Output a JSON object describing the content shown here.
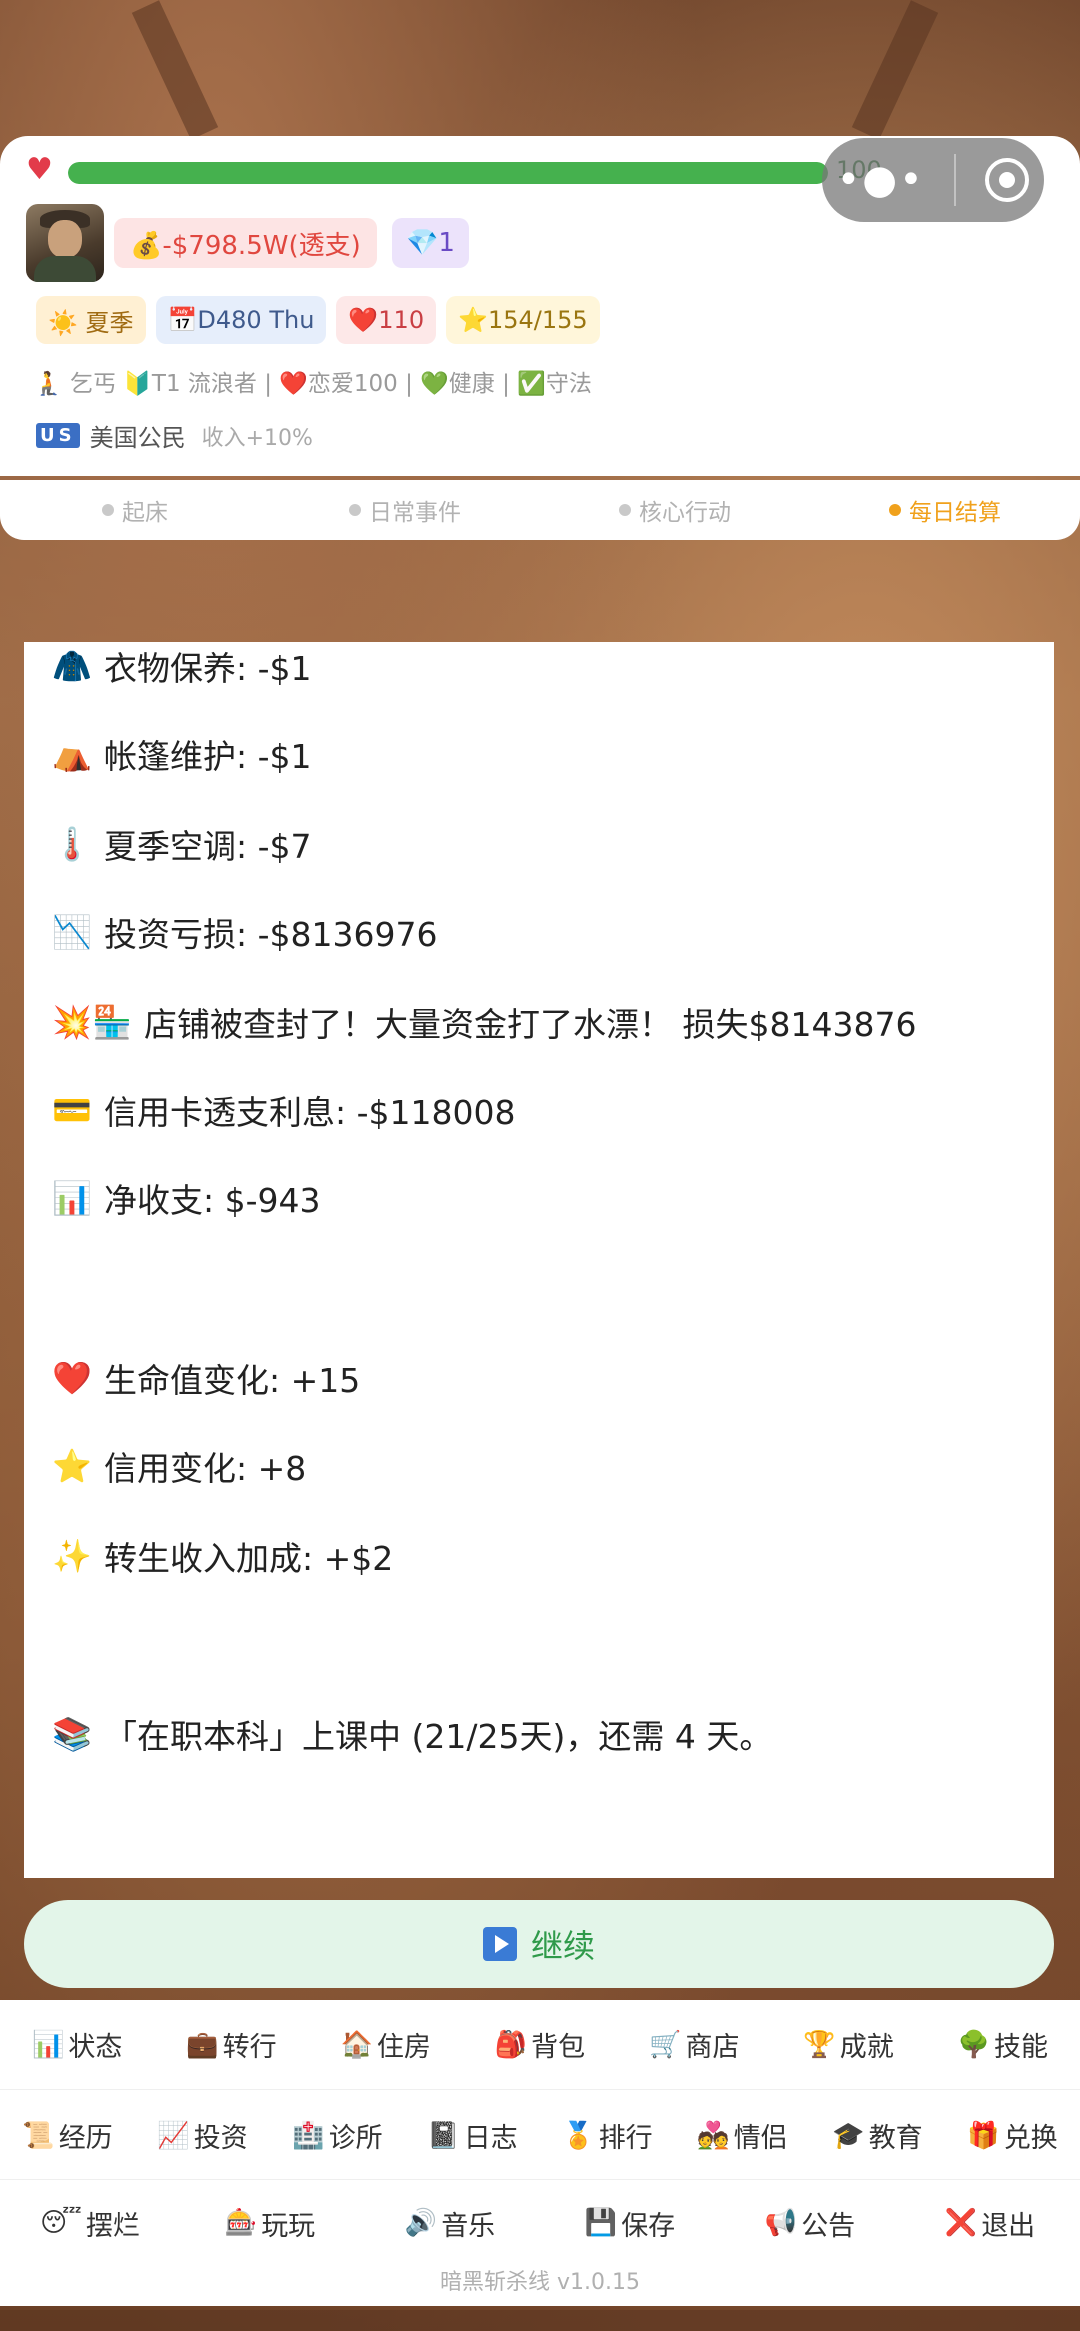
{
  "header": {
    "hp": {
      "value": "100",
      "fraction": 1.0
    },
    "money": "💰-$798.5W(透支)",
    "gems": "💎1",
    "chips": {
      "season": "☀️ 夏季",
      "day": "📅D480 Thu",
      "hp": "❤️110",
      "credit": "⭐154/155"
    },
    "status_line": "🧎 乞丐 🔰T1 流浪者 | ❤️恋爱100 | 💚健康 | ✅守法",
    "citizen": {
      "flag": "US",
      "label": "美国公民",
      "bonus": "收入+10%"
    }
  },
  "steps": [
    {
      "label": "起床",
      "active": false
    },
    {
      "label": "日常事件",
      "active": false
    },
    {
      "label": "核心行动",
      "active": false
    },
    {
      "label": "每日结算",
      "active": true
    }
  ],
  "log": [
    {
      "icon": "🧥",
      "text": "衣物保养: -$1"
    },
    {
      "icon": "⛺",
      "text": "帐篷维护: -$1"
    },
    {
      "icon": "🌡️",
      "text": "夏季空调: -$7"
    },
    {
      "icon": "📉",
      "text": "投资亏损: -$8136976"
    },
    {
      "icon": "💥🏪",
      "text": "店铺被查封了！大量资金打了水漂！ 损失$8143876"
    },
    {
      "icon": "💳",
      "text": "信用卡透支利息: -$118008"
    },
    {
      "icon": "📊",
      "text": "净收支: $-943"
    },
    {
      "icon": "❤️",
      "text": "生命值变化: +15"
    },
    {
      "icon": "⭐",
      "text": "信用变化: +8"
    },
    {
      "icon": "✨",
      "text": "转生收入加成: +$2"
    },
    {
      "icon": "📚",
      "text": "「在职本科」上课中 (21/25天)，还需 4 天。"
    }
  ],
  "continue_label": "继续",
  "menu": {
    "row1": [
      {
        "icon": "📊",
        "label": "状态"
      },
      {
        "icon": "💼",
        "label": "转行"
      },
      {
        "icon": "🏠",
        "label": "住房"
      },
      {
        "icon": "🎒",
        "label": "背包"
      },
      {
        "icon": "🛒",
        "label": "商店"
      },
      {
        "icon": "🏆",
        "label": "成就"
      },
      {
        "icon": "🌳",
        "label": "技能"
      }
    ],
    "row2": [
      {
        "icon": "📜",
        "label": "经历"
      },
      {
        "icon": "📈",
        "label": "投资"
      },
      {
        "icon": "🏥",
        "label": "诊所"
      },
      {
        "icon": "📓",
        "label": "日志"
      },
      {
        "icon": "🏅",
        "label": "排行"
      },
      {
        "icon": "💑",
        "label": "情侣"
      },
      {
        "icon": "🎓",
        "label": "教育"
      },
      {
        "icon": "🎁",
        "label": "兑换"
      }
    ],
    "row3": [
      {
        "icon": "😴",
        "label": "摆烂"
      },
      {
        "icon": "🎰",
        "label": "玩玩"
      },
      {
        "icon": "🔊",
        "label": "音乐"
      },
      {
        "icon": "💾",
        "label": "保存"
      },
      {
        "icon": "📢",
        "label": "公告"
      },
      {
        "icon": "❌",
        "label": "退出"
      }
    ]
  },
  "version": "暗黑斩杀线 v1.0.15",
  "colors": {
    "accent_orange": "#f0a11c",
    "hp_green": "#45b14e",
    "continue_bg": "#e3f5e9"
  }
}
